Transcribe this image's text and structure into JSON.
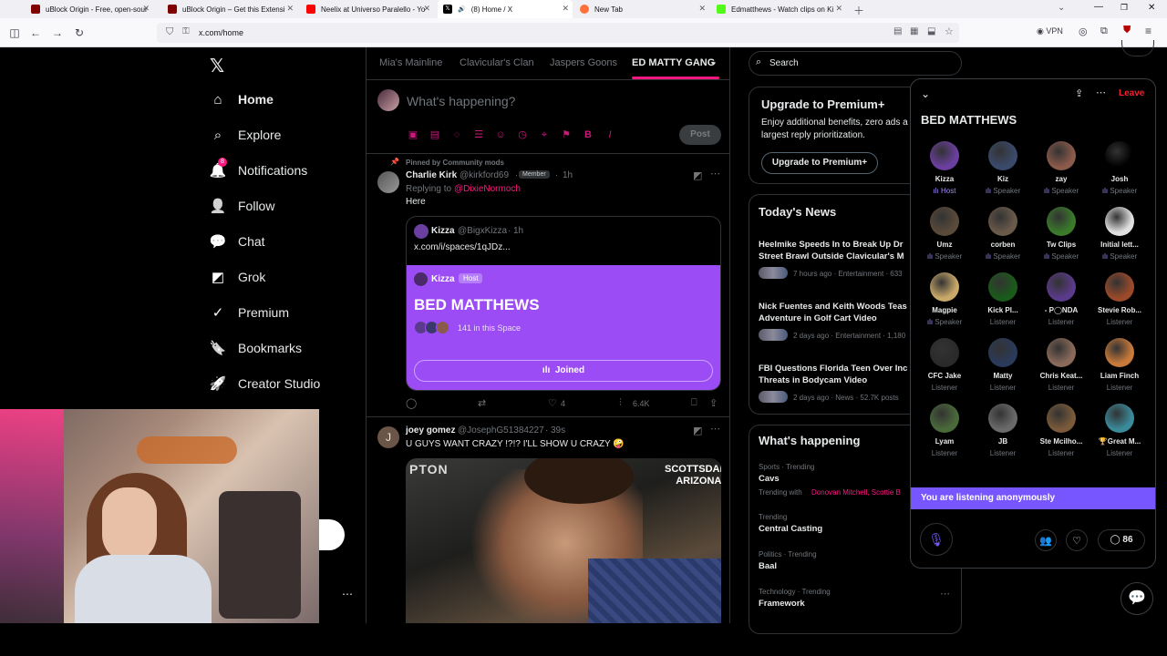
{
  "browser": {
    "tabs": [
      {
        "title": "uBlock Origin - Free, open-sour",
        "favicon_color": "#800000"
      },
      {
        "title": "uBlock Origin – Get this Extensi",
        "favicon_color": "#800000"
      },
      {
        "title": "Neelix at Universo Paralello - Yo",
        "favicon_color": "#ff0000"
      },
      {
        "title": "(8) Home / X",
        "favicon_color": "#000000"
      },
      {
        "title": "New Tab",
        "favicon_color": "#ff7139"
      },
      {
        "title": "Edmatthews - Watch clips on Ki",
        "favicon_color": "#53fc18"
      }
    ],
    "active_tab_index": 3,
    "url": "x.com/home",
    "vpn_label": "VPN"
  },
  "nav": {
    "items": [
      {
        "label": "Home",
        "icon": "home-icon",
        "glyph": "⌂"
      },
      {
        "label": "Explore",
        "icon": "search-icon",
        "glyph": "⌕"
      },
      {
        "label": "Notifications",
        "icon": "bell-icon",
        "glyph": "🔔"
      },
      {
        "label": "Follow",
        "icon": "person-add-icon",
        "glyph": "👤"
      },
      {
        "label": "Chat",
        "icon": "chat-icon",
        "glyph": "💬"
      },
      {
        "label": "Grok",
        "icon": "grok-icon",
        "glyph": "◩"
      },
      {
        "label": "Premium",
        "icon": "verified-icon",
        "glyph": "✓"
      },
      {
        "label": "Bookmarks",
        "icon": "bookmark-icon",
        "glyph": "🔖"
      },
      {
        "label": "Creator Studio",
        "icon": "rocket-icon",
        "glyph": "🚀"
      }
    ],
    "notifications_badge": "8"
  },
  "timeline_tabs": [
    {
      "label": "Mia's Mainline"
    },
    {
      "label": "Clavicular's Clan"
    },
    {
      "label": "Jaspers Goons"
    },
    {
      "label": "ED MATTY GANG"
    }
  ],
  "compose": {
    "placeholder": "What's happening?",
    "post_label": "Post"
  },
  "tweet1": {
    "pinned_label": "Pinned by Community mods",
    "name": "Charlie Kirk",
    "handle": "@kirkford69",
    "member_badge": "Member",
    "time": "1h",
    "replying_to_label": "Replying to",
    "replying_to": "@DixieNormoch",
    "text": "Here",
    "quote": {
      "name": "Kizza",
      "handle": "@BigxKizza",
      "time": "1h",
      "link": "x.com/i/spaces/1qJDz..."
    },
    "space_card": {
      "host_name": "Kizza",
      "host_badge": "Host",
      "title": "BED MATTHEWS",
      "count": "141 in this Space",
      "joined_label": "Joined",
      "color": "#9c4cf5"
    },
    "stats": {
      "likes": "4",
      "views": "6.4K"
    }
  },
  "tweet2": {
    "avatar_letter": "J",
    "name": "joey gomez",
    "handle": "@JosephG51384227",
    "time": "39s",
    "text": "U GUYS WANT CRAZY !?!? I'LL SHOW U CRAZY 🤪",
    "video_overlay": "SCOTTSDALE\nARIZONA",
    "video_corner": "PTON"
  },
  "right": {
    "search_placeholder": "Search",
    "premium": {
      "title": "Upgrade to Premium+",
      "body": "Enjoy additional benefits, zero ads a largest reply prioritization.",
      "body_line1": "Enjoy additional benefits, zero ads a",
      "body_line2": "largest reply prioritization.",
      "button": "Upgrade to Premium+"
    },
    "news_title": "Today's News",
    "news": [
      {
        "line1": "Heelmike Speeds In to Break Up Dr",
        "line2": "Street Brawl Outside Clavicular's M",
        "meta": "7 hours ago · Entertainment · 633"
      },
      {
        "line1": "Nick Fuentes and Keith Woods Teas",
        "line2": "Adventure in Golf Cart Video",
        "meta": "2 days ago · Entertainment · 1,180"
      },
      {
        "line1": "FBI Questions Florida Teen Over Inc",
        "line2": "Threats in Bodycam Video",
        "meta": "2 days ago · News · 52.7K posts"
      }
    ],
    "happening_title": "What's happening",
    "trends": [
      {
        "category": "Sports · Trending",
        "name": "Cavs",
        "with_label": "Trending with",
        "with": "Donovan Mitchell, Scottie B"
      },
      {
        "category": "Trending",
        "name": "Central Casting"
      },
      {
        "category": "Politics · Trending",
        "name": "Baal"
      },
      {
        "category": "Technology · Trending",
        "name": "Framework"
      }
    ]
  },
  "spaces": {
    "leave_label": "Leave",
    "title": "BED MATTHEWS",
    "participants": [
      {
        "name": "Kizza",
        "role": "Host",
        "color": "#6b3fa0"
      },
      {
        "name": "Kiz",
        "role": "Speaker",
        "color": "#3b4a6b"
      },
      {
        "name": "zay",
        "role": "Speaker",
        "color": "#8a5a4a"
      },
      {
        "name": "Josh",
        "role": "Speaker",
        "color": "#000000"
      },
      {
        "name": "Umz",
        "role": "Speaker",
        "color": "#5a4a3a"
      },
      {
        "name": "corben",
        "role": "Speaker",
        "color": "#6a5a4a"
      },
      {
        "name": "Tw Clips",
        "role": "Speaker",
        "color": "#3a7a2a"
      },
      {
        "name": "Initial lett...",
        "role": "Speaker",
        "color": "#e0e0e0"
      },
      {
        "name": "Magpie",
        "role": "Speaker",
        "color": "#c9a96a"
      },
      {
        "name": "Kick Pl...",
        "role": "Listener",
        "color": "#1a5a1a"
      },
      {
        "name": "- P◯NDA",
        "role": "Listener",
        "color": "#5a3a8a"
      },
      {
        "name": "Stevie Rob...",
        "role": "Listener",
        "color": "#9a4a2a"
      },
      {
        "name": "CFC Jake",
        "role": "Listener",
        "color": "#2a2a2a"
      },
      {
        "name": "Matty",
        "role": "Listener",
        "color": "#2a3a5a"
      },
      {
        "name": "Chris Keat...",
        "role": "Listener",
        "color": "#8a6a5a"
      },
      {
        "name": "Liam Finch",
        "role": "Listener",
        "color": "#c97a3a"
      },
      {
        "name": "Lyam",
        "role": "Listener",
        "color": "#4a6a3a"
      },
      {
        "name": "JB",
        "role": "Listener",
        "color": "#6a6a6a"
      },
      {
        "name": "Ste Mcilho...",
        "role": "Listener",
        "color": "#7a5a3a"
      },
      {
        "name": "🏆Great M...",
        "role": "Listener",
        "color": "#3a8a9a"
      }
    ],
    "banner": "You are listening anonymously",
    "chat_count": "86"
  }
}
